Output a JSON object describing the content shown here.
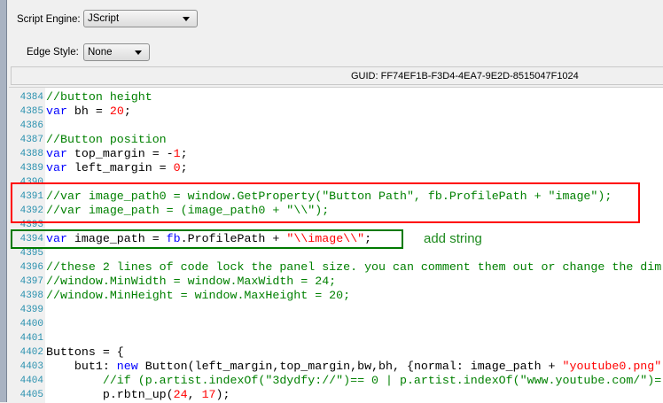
{
  "form": {
    "script_engine_label": "Script Engine:",
    "script_engine_value": "JScript",
    "edge_style_label": "Edge Style:",
    "edge_style_value": "None",
    "guid": "GUID: FF74EF1B-F3D4-4EA7-9E2D-8515047F1024"
  },
  "annotation": {
    "note": "add string",
    "red_box_color": "#ff0000",
    "green_box_color": "#007a00"
  },
  "editor": {
    "lines": [
      {
        "n": "4384",
        "t": [
          [
            "cm",
            "//button height"
          ]
        ]
      },
      {
        "n": "4385",
        "t": [
          [
            "kw",
            "var"
          ],
          [
            "pl",
            " bh = "
          ],
          [
            "num",
            "20"
          ],
          [
            "pl",
            ";"
          ]
        ]
      },
      {
        "n": "4386",
        "t": []
      },
      {
        "n": "4387",
        "t": [
          [
            "cm",
            "//Button position"
          ]
        ]
      },
      {
        "n": "4388",
        "t": [
          [
            "kw",
            "var"
          ],
          [
            "pl",
            " top_margin = -"
          ],
          [
            "num",
            "1"
          ],
          [
            "pl",
            ";"
          ]
        ]
      },
      {
        "n": "4389",
        "t": [
          [
            "kw",
            "var"
          ],
          [
            "pl",
            " left_margin = "
          ],
          [
            "num",
            "0"
          ],
          [
            "pl",
            ";"
          ]
        ]
      },
      {
        "n": "4390",
        "t": []
      },
      {
        "n": "4391",
        "t": [
          [
            "cm",
            "//var image_path0 = window.GetProperty(\"Button Path\", fb.ProfilePath + \"image\");"
          ]
        ]
      },
      {
        "n": "4392",
        "t": [
          [
            "cm",
            "//var image_path = (image_path0 + \"\\\\\");"
          ]
        ]
      },
      {
        "n": "4393",
        "t": []
      },
      {
        "n": "4394",
        "t": [
          [
            "kw",
            "var"
          ],
          [
            "pl",
            " image_path = "
          ],
          [
            "kw",
            "fb"
          ],
          [
            "pl",
            ".ProfilePath + "
          ],
          [
            "str",
            "\"\\\\image\\\\\""
          ],
          [
            "pl",
            ";"
          ]
        ]
      },
      {
        "n": "4395",
        "t": []
      },
      {
        "n": "4396",
        "t": [
          [
            "cm",
            "//these 2 lines of code lock the panel size. you can comment them out or change the dim"
          ]
        ]
      },
      {
        "n": "4397",
        "t": [
          [
            "cm",
            "//window.MinWidth = window.MaxWidth = 24;"
          ]
        ]
      },
      {
        "n": "4398",
        "t": [
          [
            "cm",
            "//window.MinHeight = window.MaxHeight = 20;"
          ]
        ]
      },
      {
        "n": "4399",
        "t": []
      },
      {
        "n": "4400",
        "t": []
      },
      {
        "n": "4401",
        "t": []
      },
      {
        "n": "4402",
        "t": [
          [
            "pl",
            "Buttons = {"
          ]
        ]
      },
      {
        "n": "4403",
        "t": [
          [
            "pl",
            "    but1: "
          ],
          [
            "kw",
            "new"
          ],
          [
            "pl",
            " Button(left_margin,top_margin,bw,bh, {normal: image_path + "
          ],
          [
            "str",
            "\"youtube0.png\""
          ]
        ]
      },
      {
        "n": "4404",
        "t": [
          [
            "cm",
            "        //if (p.artist.indexOf(\"3dydfy://\")== 0 | p.artist.indexOf(\"www.youtube.com/\")="
          ]
        ]
      },
      {
        "n": "4405",
        "t": [
          [
            "pl",
            "        p.rbtn_up("
          ],
          [
            "num",
            "24"
          ],
          [
            "pl",
            ", "
          ],
          [
            "num",
            "17"
          ],
          [
            "pl",
            ");"
          ]
        ]
      }
    ]
  }
}
